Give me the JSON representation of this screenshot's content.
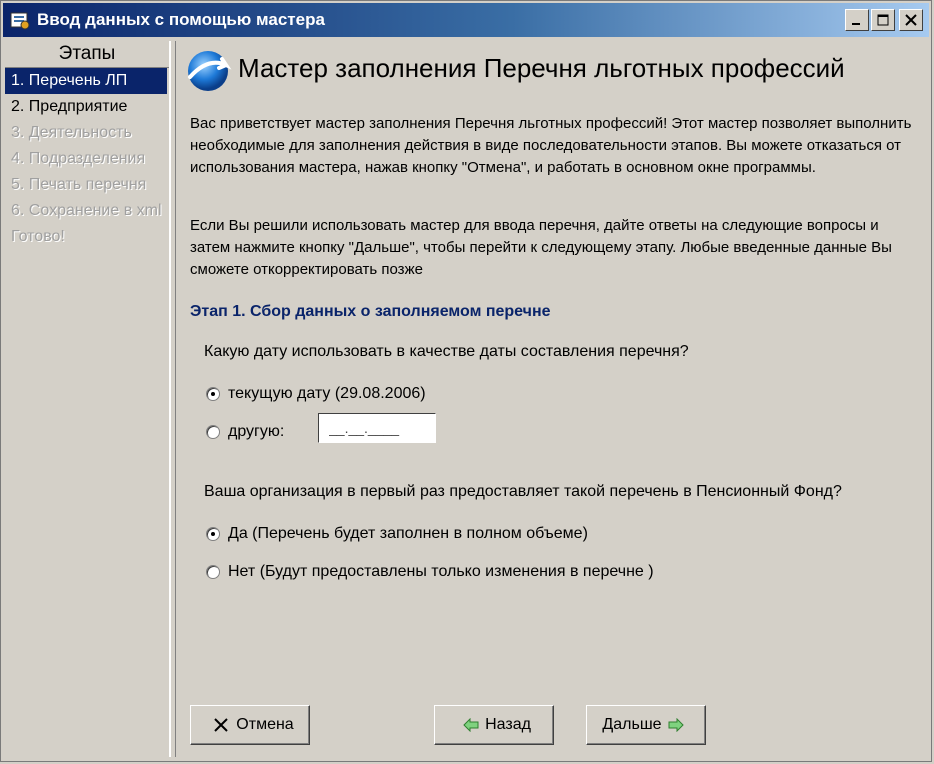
{
  "window": {
    "title": "Ввод данных с помощью мастера"
  },
  "sidebar": {
    "header": "Этапы",
    "steps": [
      {
        "label": "1. Перечень ЛП",
        "state": "active"
      },
      {
        "label": "2. Предприятие",
        "state": "enabled"
      },
      {
        "label": "3. Деятельность",
        "state": "disabled"
      },
      {
        "label": "4. Подразделения",
        "state": "disabled"
      },
      {
        "label": "5. Печать перечня",
        "state": "disabled"
      },
      {
        "label": "6. Сохранение в xml",
        "state": "disabled"
      },
      {
        "label": "Готово!",
        "state": "disabled"
      }
    ]
  },
  "main": {
    "title": "Мастер заполнения Перечня льготных профессий",
    "intro1": "Вас приветствует мастер заполнения Перечня льготных профессий! Этот мастер позволяет выполнить необходимые для заполнения действия в виде последовательности этапов. Вы можете отказаться от использования мастера, нажав кнопку \"Отмена\", и работать в основном окне программы.",
    "intro2": "Если Вы решили использовать мастер для ввода перечня, дайте ответы на следующие вопросы и затем нажмите кнопку \"Дальше\", чтобы перейти к следующему этапу. Любые введенные данные Вы сможете откорректировать позже",
    "stage_title": "Этап 1. Сбор данных о заполняемом перечне",
    "q1": "Какую дату использовать в качестве даты составления перечня?",
    "q1_opt1": "текущую дату (29.08.2006)",
    "q1_opt2": "другую:",
    "date_value": "__.__.____",
    "q2": "Ваша организация в первый раз предоставляет такой перечень в Пенсионный Фонд?",
    "q2_opt1": "Да (Перечень будет заполнен в полном объеме)",
    "q2_opt2": "Нет (Будут предоставлены только изменения в перечне )"
  },
  "buttons": {
    "cancel": "Отмена",
    "back": "Назад",
    "next": "Дальше"
  },
  "colors": {
    "title_bar": "#0a246a",
    "stage_text": "#0a246a",
    "face": "#d4d0c8"
  }
}
